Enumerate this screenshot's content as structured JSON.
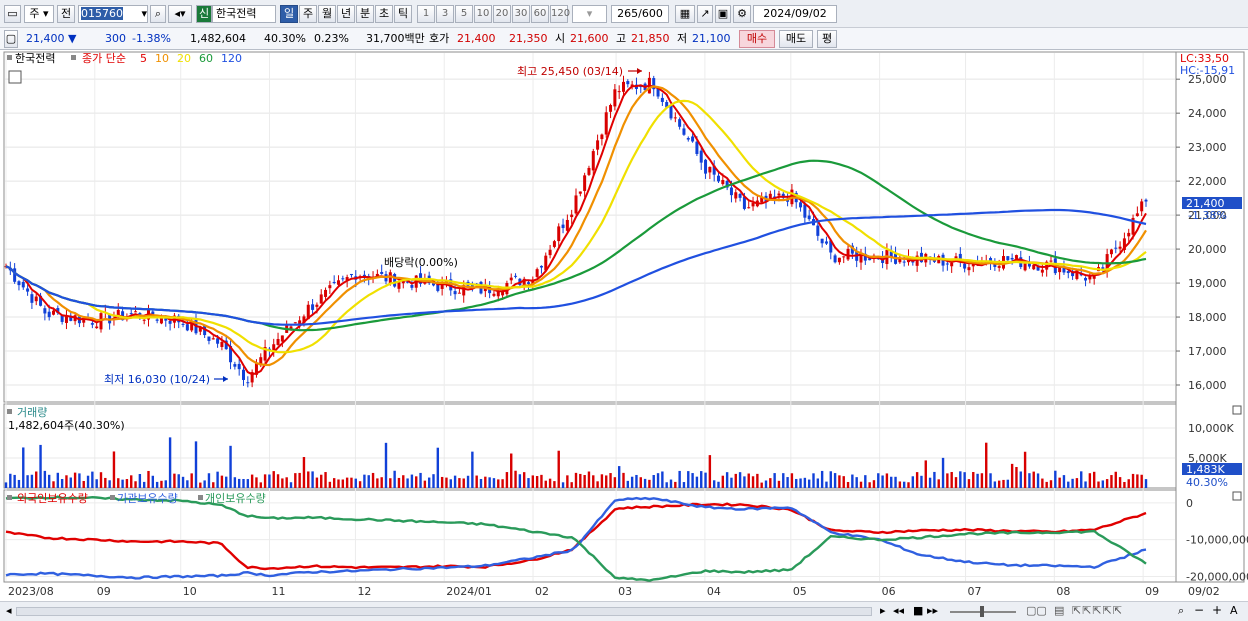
{
  "toolbar": {
    "market": "주",
    "prev_label": "전",
    "code": "015760",
    "name_badge": "신",
    "name": "한국전력",
    "periods": [
      "일",
      "주",
      "월",
      "년",
      "분",
      "초",
      "틱"
    ],
    "active_period": "일",
    "intervals": [
      "1",
      "3",
      "5",
      "10",
      "20",
      "30",
      "60",
      "120"
    ],
    "count": "265",
    "count_total": "/600",
    "date": "2024/09/02"
  },
  "quote": {
    "price": "21,400",
    "change": "300",
    "change_pct": "-1.38%",
    "volume": "1,482,604",
    "vol_ratio": "40.30%",
    "turnover": "0.23%",
    "amount": "31,700백만",
    "bid_label": "호가",
    "bid1": "21,400",
    "bid2": "21,350",
    "open_label": "시",
    "open": "21,600",
    "high_label": "고",
    "high": "21,850",
    "low_label": "저",
    "low": "21,100",
    "buy_label": "매수",
    "sell_label": "매도",
    "avg_label": "평"
  },
  "price_panel": {
    "stock_label": "한국전력",
    "ma_title": "종가 단순",
    "ma_periods": [
      "5",
      "10",
      "20",
      "60",
      "120"
    ],
    "ma_colors": [
      "#e00000",
      "#f09000",
      "#f0e000",
      "#1a9a3a",
      "#2050e0"
    ],
    "lc": "LC:33,50",
    "hc": "HC:-15,91",
    "y_ticks": [
      "25,000",
      "24,000",
      "23,000",
      "22,000",
      "21,000",
      "20,000",
      "19,000",
      "18,000",
      "17,000",
      "16,000"
    ],
    "current_price": "21,400",
    "current_pct": "-1.38%",
    "high_annotation": "최고 25,450 (03/14)",
    "low_annotation": "최저 16,030 (10/24)",
    "dividend_annotation": "배당락(0.00%)"
  },
  "volume_panel": {
    "title": "거래량",
    "value": "1,482,604주(40.30%)",
    "y_ticks": [
      "10,000K",
      "5,000K"
    ],
    "current": "1,483K",
    "current_pct": "40.30%"
  },
  "holding_panel": {
    "series": [
      "외국인보유수량",
      "기관보유수량",
      "개인보유수량"
    ],
    "series_colors": [
      "#e00000",
      "#3060e0",
      "#2a9a5a"
    ],
    "y_ticks": [
      "0",
      "-10,000,000",
      "-20,000,000"
    ]
  },
  "x_axis": {
    "labels": [
      "2023/08",
      "09",
      "10",
      "11",
      "12",
      "2024/01",
      "02",
      "03",
      "04",
      "05",
      "06",
      "07",
      "08",
      "09"
    ],
    "right_label": "09/02"
  },
  "chart_data": {
    "type": "line",
    "x": [
      "2023-08-01",
      "2023-08-15",
      "2023-09-01",
      "2023-09-15",
      "2023-10-01",
      "2023-10-15",
      "2023-10-24",
      "2023-11-01",
      "2023-11-15",
      "2023-12-01",
      "2023-12-15",
      "2024-01-01",
      "2024-01-15",
      "2024-02-01",
      "2024-02-15",
      "2024-03-01",
      "2024-03-14",
      "2024-04-01",
      "2024-04-15",
      "2024-05-01",
      "2024-05-15",
      "2024-06-01",
      "2024-06-15",
      "2024-07-01",
      "2024-07-15",
      "2024-08-01",
      "2024-08-15",
      "2024-09-02"
    ],
    "series": [
      {
        "name": "종가",
        "values": [
          19500,
          18100,
          17900,
          18100,
          17900,
          17200,
          16200,
          17100,
          18300,
          19300,
          19100,
          18900,
          18800,
          19200,
          21300,
          24700,
          24900,
          22400,
          21200,
          21600,
          19800,
          19800,
          19700,
          19600,
          19700,
          19500,
          19100,
          21400
        ]
      },
      {
        "name": "외국인보유수량",
        "values": [
          -8000000,
          -9500000,
          -10000000,
          -10500000,
          -10500000,
          -11000000,
          -17500000,
          -17800000,
          -17200000,
          -17500000,
          -17500000,
          -17200000,
          -17400000,
          -15500000,
          -12500000,
          -1500000,
          -1000000,
          -400000,
          -500000,
          -1800000,
          -7500000,
          -8000000,
          -7500000,
          -7300000,
          -7600000,
          -7900000,
          -7300000,
          -2800000
        ]
      },
      {
        "name": "기관보유수량",
        "values": [
          -19500000,
          -19200000,
          -19800000,
          -20300000,
          -20000000,
          -19800000,
          -19000000,
          -19700000,
          -18800000,
          -18500000,
          -18000000,
          -17600000,
          -17100000,
          -14900000,
          -12800000,
          900000,
          1200000,
          -1200000,
          -1700000,
          -1200000,
          -8000000,
          -10000000,
          -14100000,
          -16000000,
          -16900000,
          -17100000,
          -17400000,
          -12700000
        ]
      },
      {
        "name": "개인보유수량",
        "values": [
          1200000,
          1500000,
          1300000,
          900000,
          600000,
          -600000,
          -3500000,
          -4200000,
          -4000000,
          -4400000,
          -4800000,
          -5300000,
          -5800000,
          -7800000,
          -9400000,
          -20500000,
          -21000000,
          -18500000,
          -18800000,
          -18200000,
          -9200000,
          -10000000,
          -9400000,
          -8400000,
          -8200000,
          -8000000,
          -7800000,
          -16500000
        ]
      }
    ],
    "volume_last": 1482604,
    "ylim_price": [
      15500,
      25800
    ],
    "ylim_volume": [
      0,
      14000000
    ],
    "ylim_holding": [
      -21500000,
      3500000
    ]
  }
}
